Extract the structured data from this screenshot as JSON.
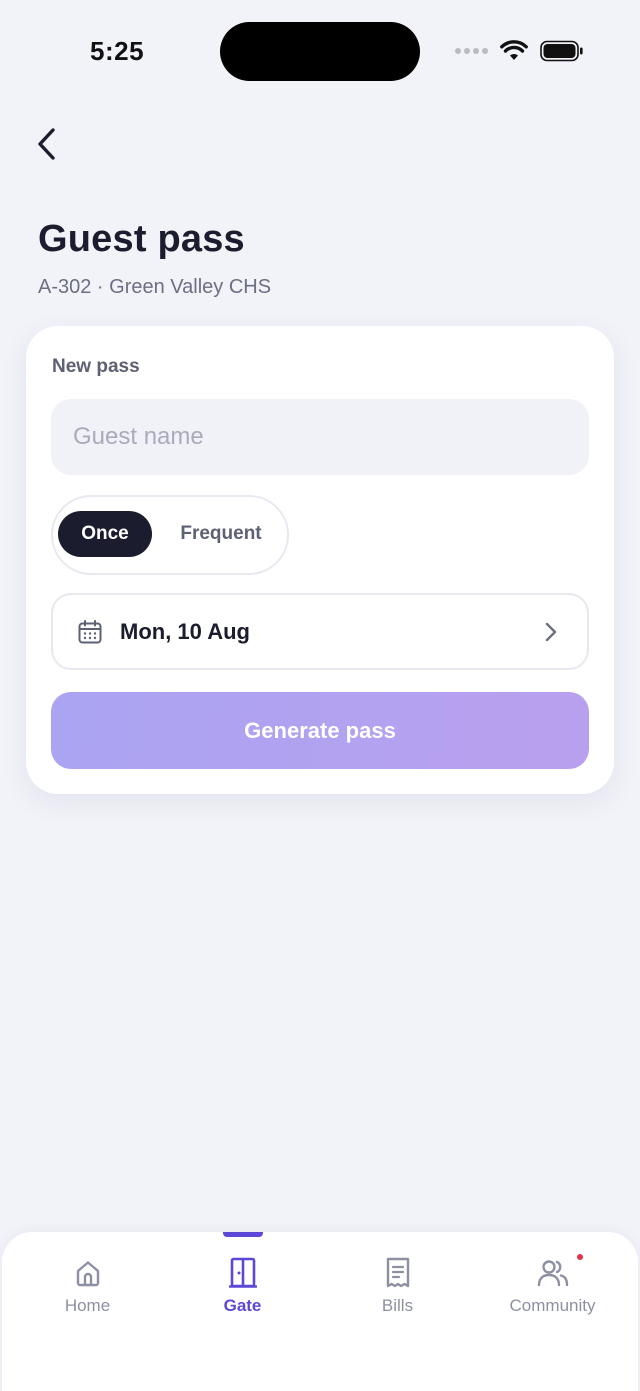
{
  "status_bar": {
    "time": "5:25"
  },
  "header": {
    "title": "Guest pass",
    "subtitle": "A-302 · Green Valley CHS"
  },
  "card": {
    "label": "New pass",
    "guest_input": {
      "placeholder": "Guest name",
      "value": ""
    },
    "frequency_toggle": {
      "options": [
        "Once",
        "Frequent"
      ],
      "selected": "Once"
    },
    "date": {
      "value": "Mon, 10 Aug"
    },
    "generate_button": {
      "label": "Generate pass"
    }
  },
  "tabbar": {
    "items": [
      {
        "label": "Home",
        "icon": "home-icon"
      },
      {
        "label": "Gate",
        "icon": "door-icon"
      },
      {
        "label": "Bills",
        "icon": "receipt-icon"
      },
      {
        "label": "Community",
        "icon": "people-icon"
      }
    ],
    "active": "Gate"
  },
  "colors": {
    "accent": "#5b48d6",
    "background": "#f2f3f9",
    "dark": "#1b1d2e",
    "button_gradient_start": "#aaa4f2",
    "button_gradient_end": "#b9a0ee",
    "notification": "#e5334a"
  }
}
